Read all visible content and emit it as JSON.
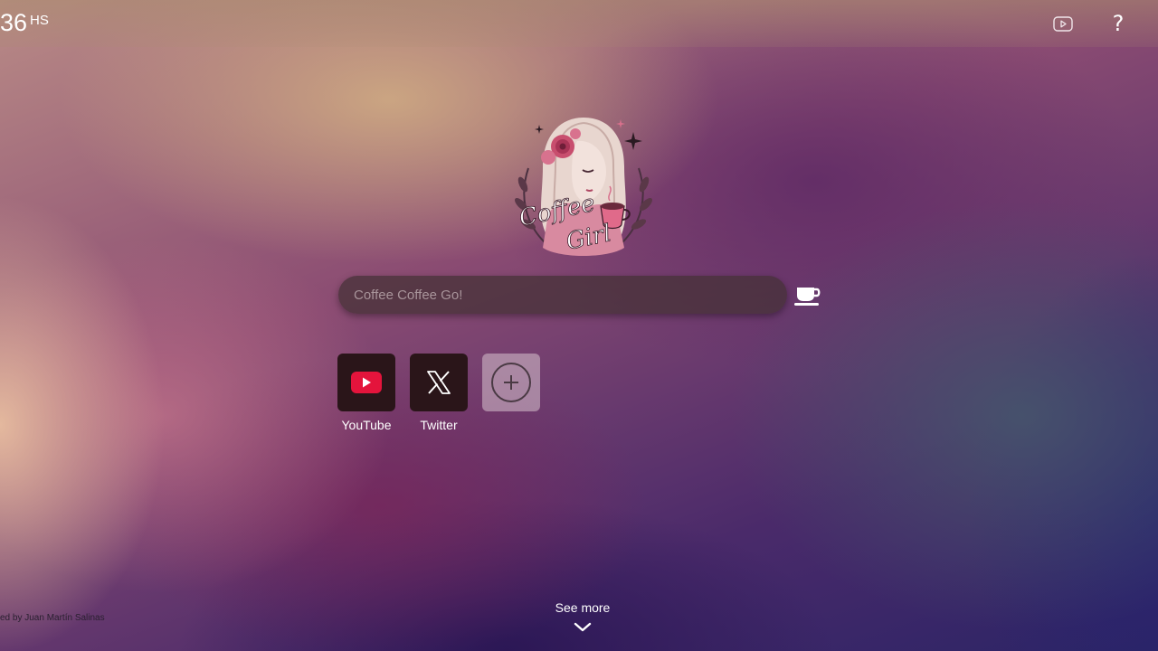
{
  "clock": {
    "time": "36",
    "suffix": "HS"
  },
  "header": {
    "video_icon": "youtube-outline-icon",
    "help_label": "?"
  },
  "logo": {
    "text_line1": "Coffee",
    "text_line2": "Girl",
    "icon": "coffee-girl-logo"
  },
  "search": {
    "placeholder": "Coffee Coffee Go!",
    "value": "",
    "submit_icon": "coffee-cup-icon"
  },
  "shortcuts": [
    {
      "label": "YouTube",
      "icon": "youtube-icon"
    },
    {
      "label": "Twitter",
      "icon": "x-logo-icon"
    },
    {
      "label": "",
      "icon": "add-circle-icon"
    }
  ],
  "footer": {
    "credit": "ed by Juan Martín Salinas",
    "see_more": "See more",
    "chevron": "chevron-down-icon"
  },
  "colors": {
    "youtube_red": "#e4143c",
    "tile_bg": "#2a1519",
    "search_bg": "#463237"
  }
}
